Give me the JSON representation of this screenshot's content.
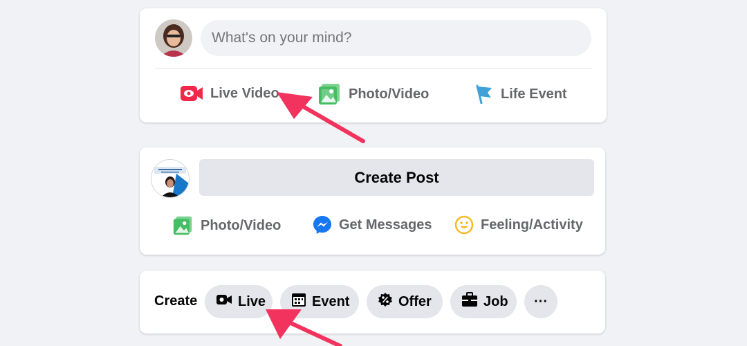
{
  "composer": {
    "placeholder": "What's on your mind?",
    "actions": [
      {
        "label": "Live Video",
        "icon": "live-video-icon"
      },
      {
        "label": "Photo/Video",
        "icon": "photo-video-icon"
      },
      {
        "label": "Life Event",
        "icon": "life-event-flag-icon"
      }
    ]
  },
  "page_composer": {
    "create_post_label": "Create Post",
    "actions": [
      {
        "label": "Photo/Video",
        "icon": "photo-video-icon"
      },
      {
        "label": "Get Messages",
        "icon": "messenger-icon"
      },
      {
        "label": "Feeling/Activity",
        "icon": "smiley-icon"
      }
    ]
  },
  "create_bar": {
    "label": "Create",
    "pills": [
      {
        "label": "Live",
        "icon": "live-camera-icon"
      },
      {
        "label": "Event",
        "icon": "calendar-icon"
      },
      {
        "label": "Offer",
        "icon": "offer-percent-icon"
      },
      {
        "label": "Job",
        "icon": "briefcase-icon"
      },
      {
        "label": "···",
        "icon": "more-icon"
      }
    ]
  },
  "colors": {
    "live_red": "#f02849",
    "photo_green": "#45bd62",
    "flag_blue": "#3ea2d8",
    "messenger_blue": "#1877f2",
    "smiley_yellow": "#f7b928",
    "annotation_arrow": "#f2335d"
  }
}
